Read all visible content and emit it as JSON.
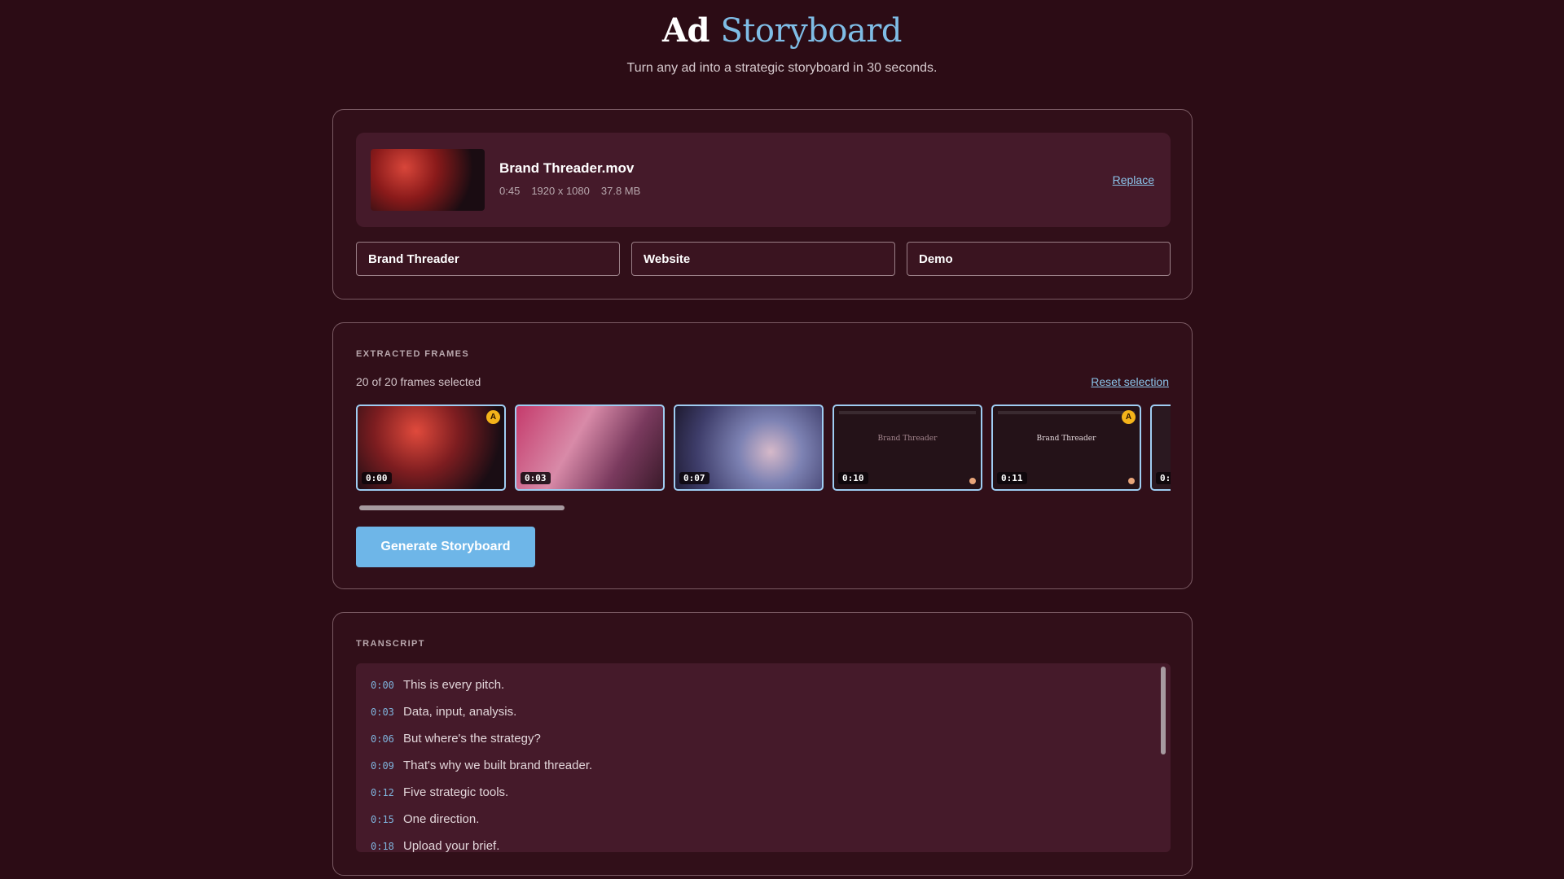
{
  "header": {
    "title_main": "Ad",
    "title_accent": "Storyboard",
    "subtitle": "Turn any ad into a strategic storyboard in 30 seconds."
  },
  "file": {
    "name": "Brand Threader.mov",
    "duration": "0:45",
    "resolution": "1920 x 1080",
    "size": "37.8 MB",
    "replace_label": "Replace"
  },
  "fields": {
    "brand": "Brand Threader",
    "channel": "Website",
    "type": "Demo"
  },
  "frames": {
    "section_label": "EXTRACTED FRAMES",
    "selected_text": "20 of 20 frames selected",
    "reset_label": "Reset selection",
    "items": [
      {
        "time": "0:00",
        "badge": "A"
      },
      {
        "time": "0:03"
      },
      {
        "time": "0:07"
      },
      {
        "time": "0:10",
        "logo": "Brand Threader"
      },
      {
        "time": "0:11",
        "badge": "A",
        "logo": "Brand Threader"
      },
      {
        "time": "0:"
      }
    ],
    "generate_label": "Generate Storyboard"
  },
  "transcript": {
    "section_label": "TRANSCRIPT",
    "lines": [
      {
        "time": "0:00",
        "text": "This is every pitch."
      },
      {
        "time": "0:03",
        "text": "Data, input, analysis."
      },
      {
        "time": "0:06",
        "text": "But where's the strategy?"
      },
      {
        "time": "0:09",
        "text": "That's why we built brand threader."
      },
      {
        "time": "0:12",
        "text": "Five strategic tools."
      },
      {
        "time": "0:15",
        "text": "One direction."
      },
      {
        "time": "0:18",
        "text": "Upload your brief."
      }
    ]
  },
  "colors": {
    "background": "#2c0c15",
    "accent": "#7fbde6",
    "button": "#6eb6e8",
    "badge": "#f4b31a"
  }
}
